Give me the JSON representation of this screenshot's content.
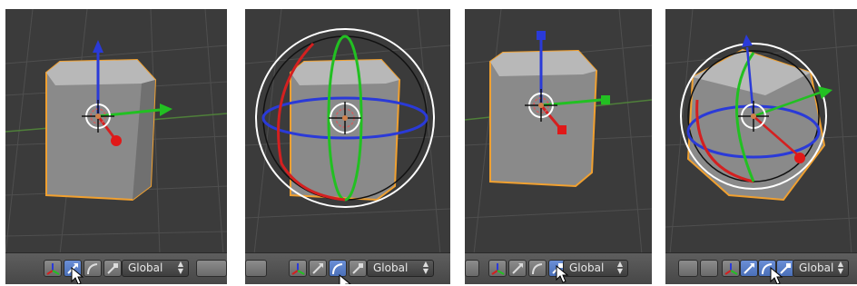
{
  "toolbar": {
    "orientation_value": "Global"
  },
  "icons": {
    "translate": "translate-manipulator-icon",
    "rotate": "rotate-manipulator-icon",
    "scale": "scale-manipulator-icon",
    "axes": "axes-manipulator-toggle-icon"
  },
  "colors": {
    "x_axis": "#d42020",
    "y_axis": "#22c022",
    "z_axis": "#2a3ad8",
    "selection_outline": "#f0a030",
    "active_button": "#5a7fd0"
  },
  "panels": [
    {
      "id": "translate",
      "active_tool": "translate"
    },
    {
      "id": "rotate",
      "active_tool": "rotate"
    },
    {
      "id": "scale",
      "active_tool": "scale"
    },
    {
      "id": "combined",
      "active_tool": "all"
    }
  ]
}
